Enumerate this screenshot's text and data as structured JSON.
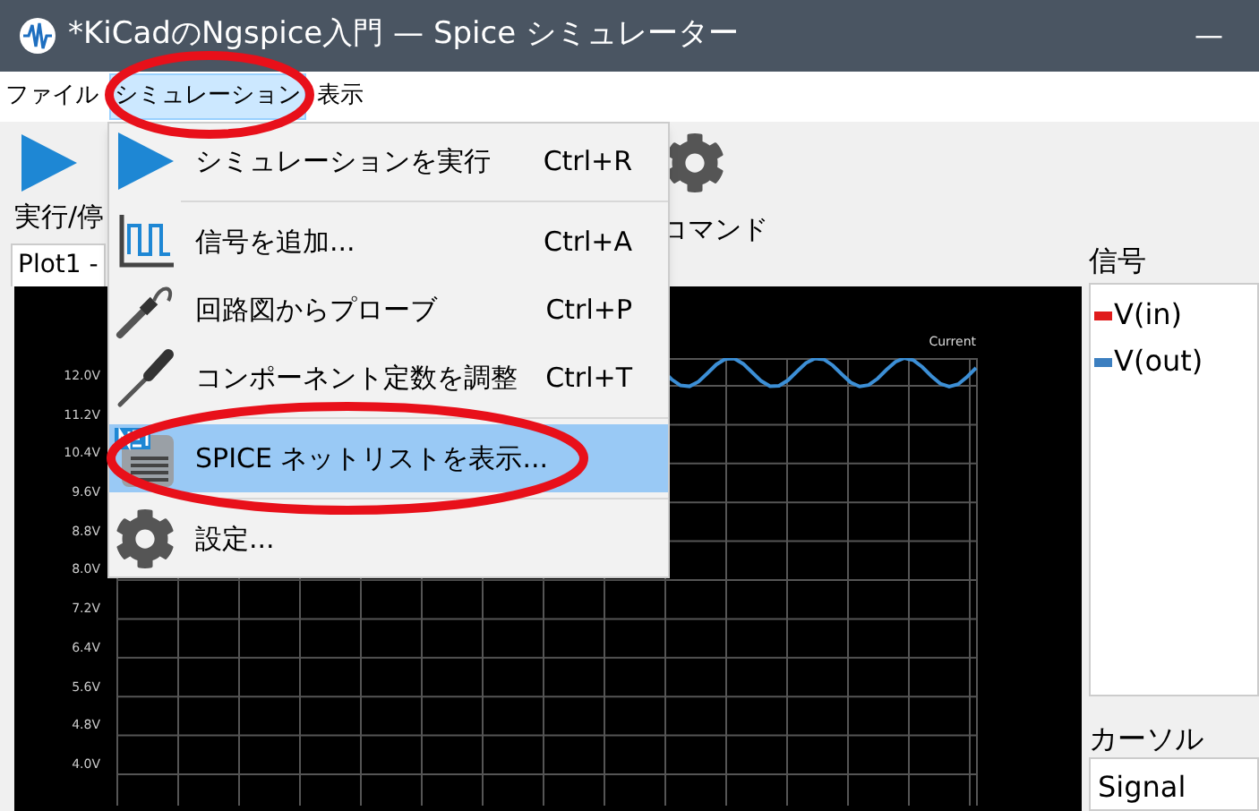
{
  "window": {
    "title": "*KiCadのNgspice入門 — Spice シミュレーター",
    "minimize": "—"
  },
  "menu_bar": [
    {
      "label": "ファイル",
      "selected": false
    },
    {
      "label": "シミュレーション",
      "selected": true
    },
    {
      "label": "表示",
      "selected": false
    }
  ],
  "toolbar": [
    {
      "kind": "play",
      "label": "実行/停"
    },
    {
      "kind": "settings",
      "label": "コマンド"
    }
  ],
  "tabs": [
    {
      "label": "Plot1 -",
      "selected": true
    }
  ],
  "plot": {
    "series_label": "Current",
    "y_axis_labels": [
      "12.0V",
      "11.2V",
      "10.4V",
      "9.6V",
      "8.8V",
      "8.0V",
      "7.2V",
      "6.4V",
      "5.6V",
      "4.8V",
      "4.0V"
    ]
  },
  "signals_panel": {
    "title": "信号",
    "items": [
      {
        "name": "V(in)",
        "color": "#e01b1b"
      },
      {
        "name": "V(out)",
        "color": "#3c7fc0"
      }
    ]
  },
  "cursor_panel": {
    "title": "カーソル",
    "column_1": "Signal"
  },
  "dropdown": [
    {
      "kind": "play",
      "label": "シミュレーションを実行",
      "shortcut": "Ctrl+R",
      "selected": false
    },
    {
      "kind": "separator"
    },
    {
      "kind": "signal",
      "label": "信号を追加...",
      "shortcut": "Ctrl+A",
      "selected": false
    },
    {
      "kind": "probe",
      "label": "回路図からプローブ",
      "shortcut": "Ctrl+P",
      "selected": false
    },
    {
      "kind": "tune",
      "label": "コンポーネント定数を調整",
      "shortcut": "Ctrl+T",
      "selected": false
    },
    {
      "kind": "separator"
    },
    {
      "kind": "netlist",
      "label": "SPICE ネットリストを表示...",
      "selected": true
    },
    {
      "kind": "separator"
    },
    {
      "kind": "settings",
      "label": "設定...",
      "selected": false
    }
  ],
  "annotations": [
    {
      "kind": "ellipse"
    },
    {
      "kind": "ellipse"
    }
  ]
}
